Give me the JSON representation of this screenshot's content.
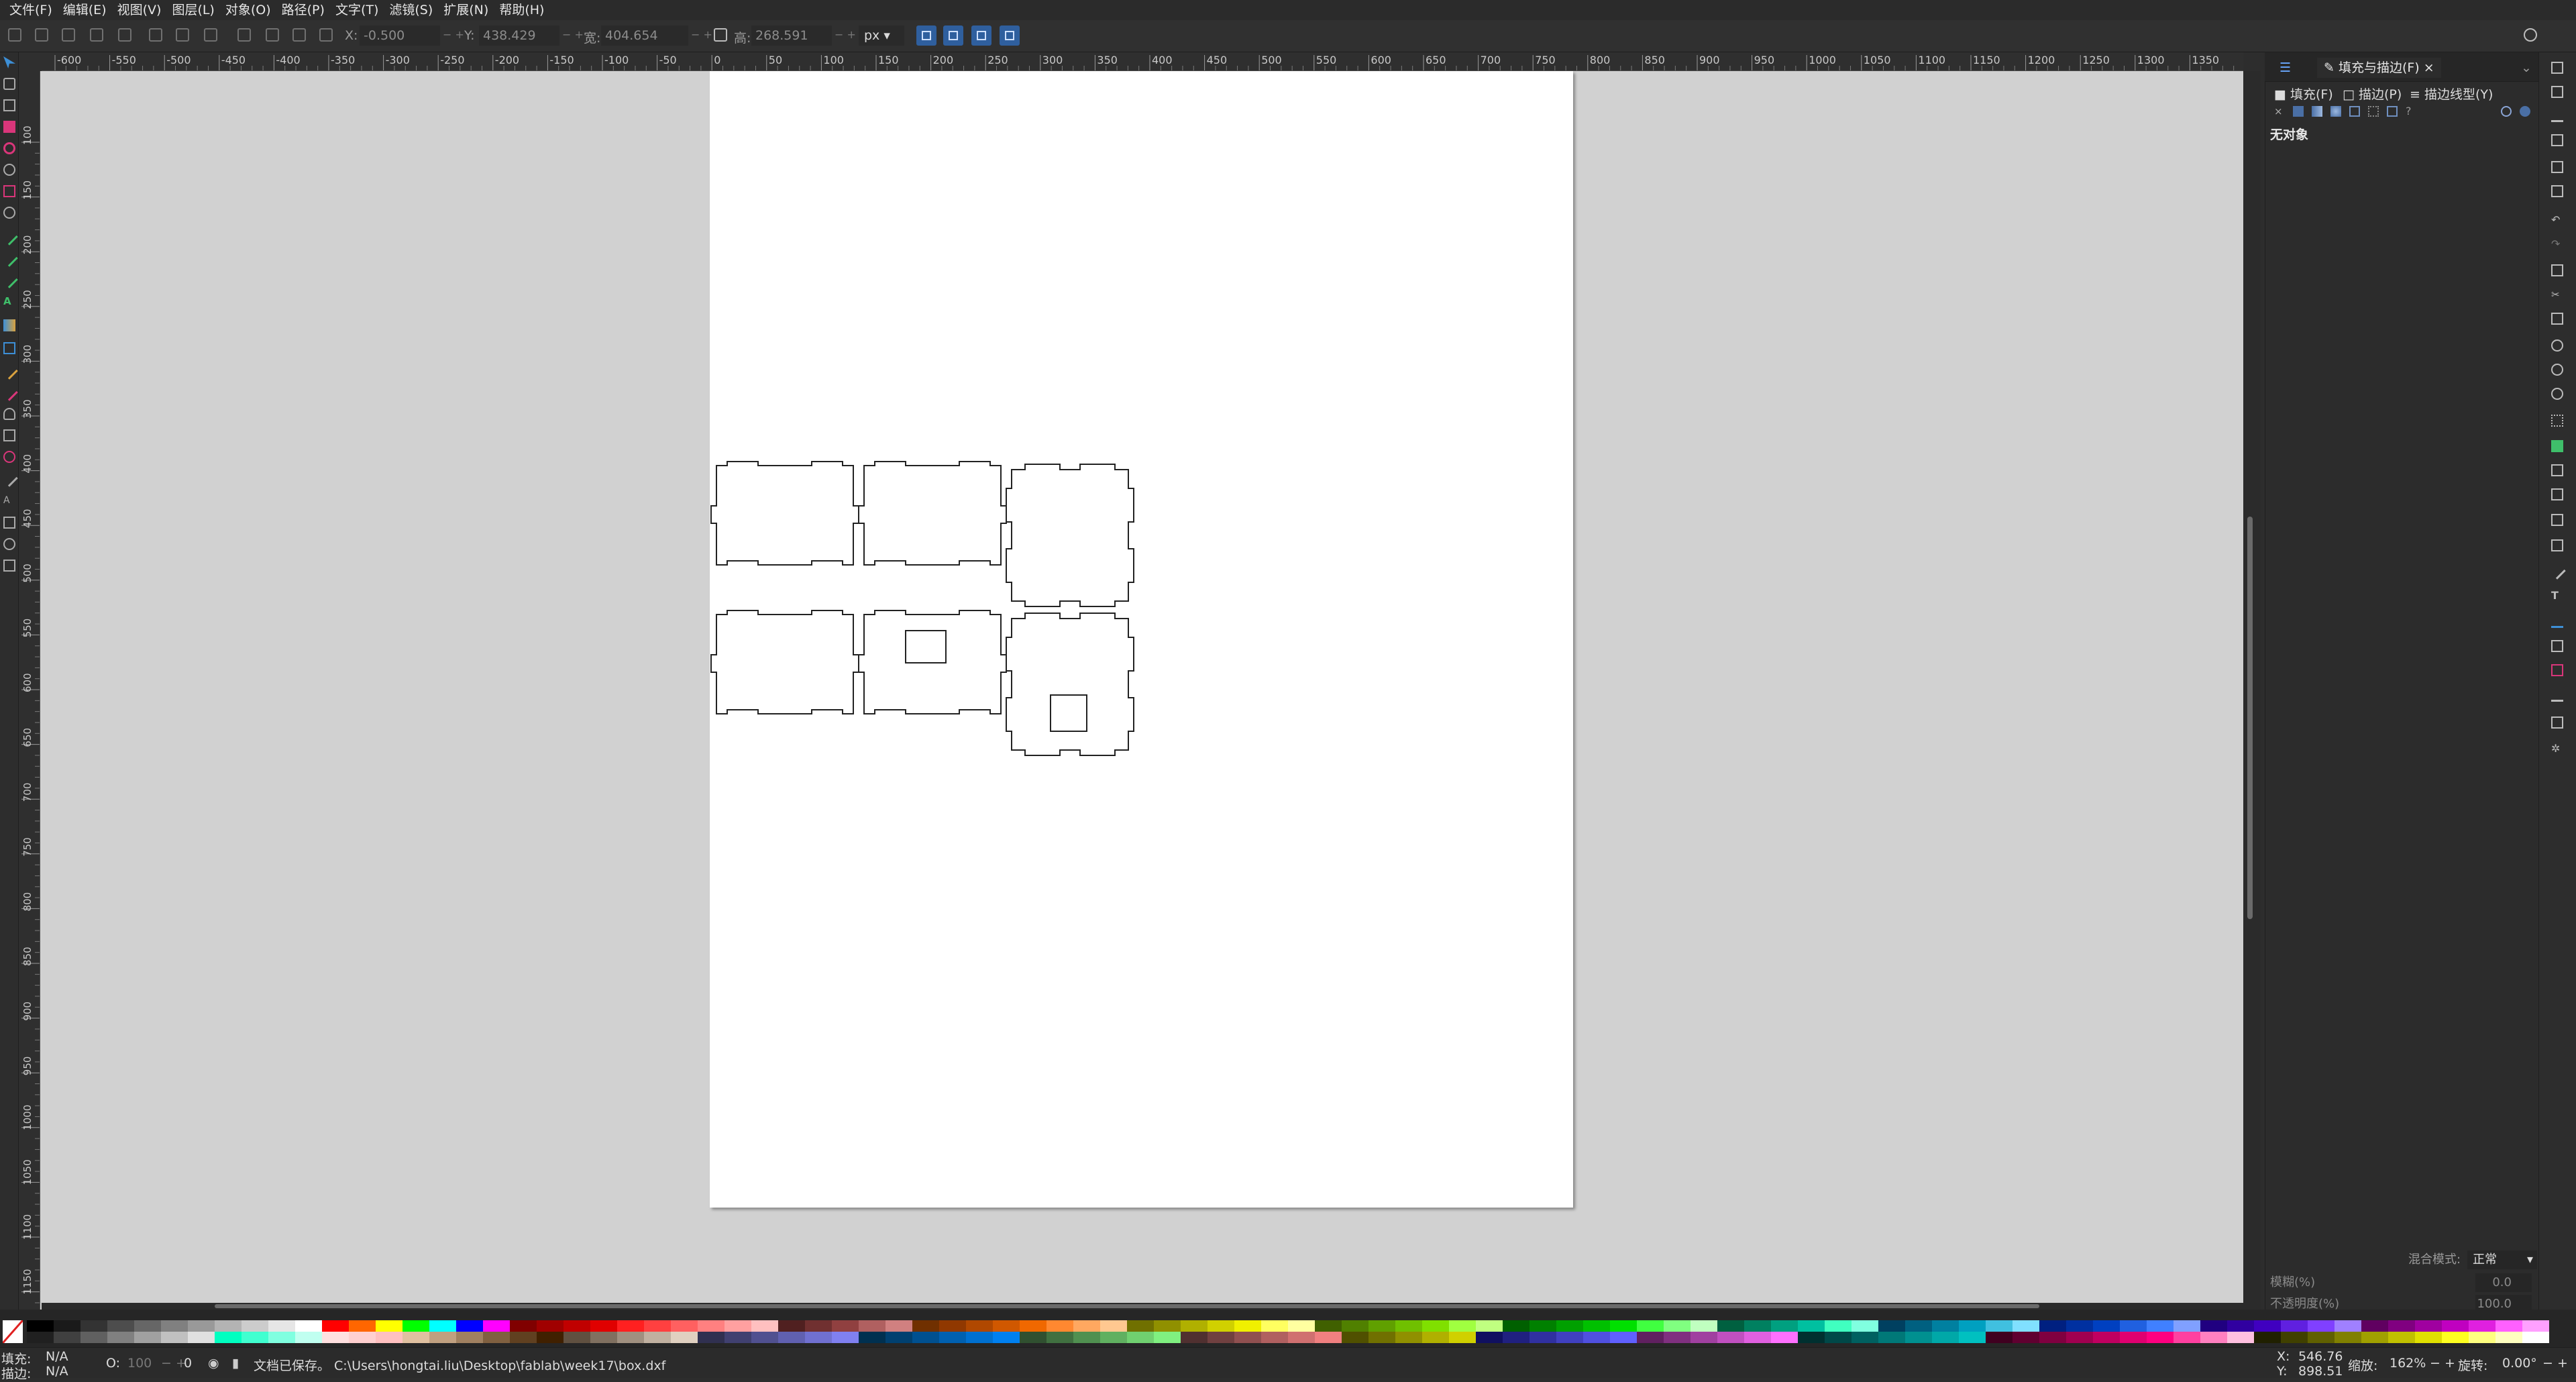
{
  "menubar": {
    "items": [
      "文件(F)",
      "编辑(E)",
      "视图(V)",
      "图层(L)",
      "对象(O)",
      "路径(P)",
      "文字(T)",
      "滤镜(S)",
      "扩展(N)",
      "帮助(H)"
    ]
  },
  "controls": {
    "x_label": "X:",
    "x_value": "-0.500",
    "y_label": "Y:",
    "y_value": "438.429",
    "w_label": "宽:",
    "w_value": "404.654",
    "h_label": "高:",
    "h_value": "268.591",
    "unit": "px"
  },
  "rulers": {
    "h_ticks": [
      "-600",
      "-550",
      "-500",
      "-450",
      "-400",
      "-350",
      "-300",
      "-250",
      "-200",
      "-150",
      "-100",
      "-50",
      "0",
      "50",
      "100",
      "150",
      "200",
      "250",
      "300",
      "350",
      "400",
      "450",
      "500",
      "550",
      "600",
      "650",
      "700",
      "750",
      "800",
      "850",
      "900",
      "950",
      "1000",
      "1050",
      "1100",
      "1150",
      "1200",
      "1250",
      "1300",
      "1350"
    ],
    "v_ticks": [
      "100",
      "150",
      "200",
      "250",
      "300",
      "350",
      "400",
      "450",
      "500",
      "550",
      "600",
      "650",
      "700",
      "750",
      "800",
      "850",
      "900",
      "950",
      "1000",
      "1050",
      "1100",
      "1150"
    ]
  },
  "dock": {
    "tab_title": "填充与描边(F)",
    "tab_close": "×",
    "subtabs": {
      "fill": "填充(F)",
      "stroke_paint": "描边(P)",
      "stroke_style": "描边线型(Y)"
    },
    "unknown_btn": "?",
    "no_object": "无对象",
    "blend_label": "混合模式:",
    "blend_value": "正常",
    "blur_label": "模糊(%)",
    "blur_value": "0.0",
    "opacity_label": "不透明度(%)",
    "opacity_value": "100.0"
  },
  "statusbar": {
    "fill_label": "填充:",
    "fill_value": "N/A",
    "stroke_label": "描边:",
    "stroke_value": "N/A",
    "o_label": "O:",
    "o_value": "100",
    "layer_value": "0",
    "message": "文档已保存。 C:\\Users\\hongtai.liu\\Desktop\\fablab\\week17\\box.dxf",
    "x_label": "X:",
    "x_value": "546.76",
    "y_label": "Y:",
    "y_value": "898.51",
    "zoom_label": "缩放:",
    "zoom_value": "162%",
    "rotate_label": "旋转:",
    "rotate_value": "0.00°"
  },
  "colors": {
    "accent": "#2f5f9e",
    "canvas": "#d1d1d1",
    "page": "#ffffff"
  },
  "palette": {
    "row1": [
      "#000000",
      "#1a1a1a",
      "#333333",
      "#4d4d4d",
      "#666666",
      "#808080",
      "#999999",
      "#b3b3b3",
      "#cccccc",
      "#e6e6e6",
      "#ffffff",
      "#ff0000",
      "#ff6600",
      "#ffff00",
      "#00ff00",
      "#00ffff",
      "#0000ff",
      "#ff00ff",
      "#800000",
      "#a00000",
      "#c00000",
      "#e00000",
      "#ff2020",
      "#ff4040",
      "#ff6060",
      "#ff8080",
      "#ffa0a0",
      "#ffc0c0",
      "#502020",
      "#703030",
      "#904040",
      "#b06060",
      "#d08080",
      "#703000",
      "#903800",
      "#b04800",
      "#d05800",
      "#f06800",
      "#ff8830",
      "#ffa860",
      "#ffc890",
      "#707000",
      "#909000",
      "#b0b000",
      "#d0d000",
      "#f0f000",
      "#ffff60",
      "#ffffa0",
      "#406000",
      "#508000",
      "#60a000",
      "#70c000",
      "#80e000",
      "#a0ff40",
      "#c0ff80",
      "#006000",
      "#008000",
      "#00a000",
      "#00c000",
      "#00e000",
      "#40ff40",
      "#80ff80",
      "#c0ffc0",
      "#006040",
      "#008060",
      "#00a080",
      "#00c0a0",
      "#40ffc0",
      "#80ffe0",
      "#004060",
      "#006080",
      "#0080a0",
      "#00a0c0",
      "#40c0e0",
      "#80e0ff",
      "#002080",
      "#0030a0",
      "#0040c0",
      "#2060e0",
      "#4080ff",
      "#80a0ff",
      "#200080",
      "#3000a0",
      "#4000c0",
      "#6020e0",
      "#8040ff",
      "#a080ff",
      "#600060",
      "#800080",
      "#a000a0",
      "#c000c0",
      "#e020e0",
      "#ff60ff",
      "#ffa0ff"
    ],
    "row2": [
      "#202020",
      "#404040",
      "#606060",
      "#808080",
      "#a0a0a0",
      "#c0c0c0",
      "#e0e0e0",
      "#00ffc0",
      "#40ffd0",
      "#80ffe0",
      "#c0fff0",
      "#ffe0e0",
      "#ffd0d0",
      "#ffc0c0",
      "#e0c0a0",
      "#c0a080",
      "#a08060",
      "#806040",
      "#604020",
      "#402000",
      "#605040",
      "#807060",
      "#a09080",
      "#c0b0a0",
      "#e0d0c0",
      "#303050",
      "#404070",
      "#505090",
      "#6060b0",
      "#7070d0",
      "#8080f0",
      "#003050",
      "#004070",
      "#005090",
      "#0060b0",
      "#0070d0",
      "#0080f0",
      "#305030",
      "#407040",
      "#509050",
      "#60b060",
      "#70d070",
      "#80f080",
      "#503030",
      "#704040",
      "#905050",
      "#b06060",
      "#d07070",
      "#f08080",
      "#505000",
      "#707000",
      "#909000",
      "#b0b000",
      "#d0d000",
      "#101060",
      "#202080",
      "#3030a0",
      "#4040c0",
      "#5050e0",
      "#6060ff",
      "#602060",
      "#803080",
      "#a040a0",
      "#c050c0",
      "#e060e0",
      "#ff70ff",
      "#003030",
      "#004848",
      "#006060",
      "#007878",
      "#009090",
      "#00a8a8",
      "#00c0c0",
      "#400020",
      "#600030",
      "#800040",
      "#a00050",
      "#c00060",
      "#e00070",
      "#ff0080",
      "#ff40a0",
      "#ff80c0",
      "#ffc0e0",
      "#202000",
      "#404000",
      "#606000",
      "#808000",
      "#a0a000",
      "#c0c000",
      "#e0e000",
      "#ffff20",
      "#ffff80",
      "#ffffc0",
      "#ffffff"
    ]
  }
}
